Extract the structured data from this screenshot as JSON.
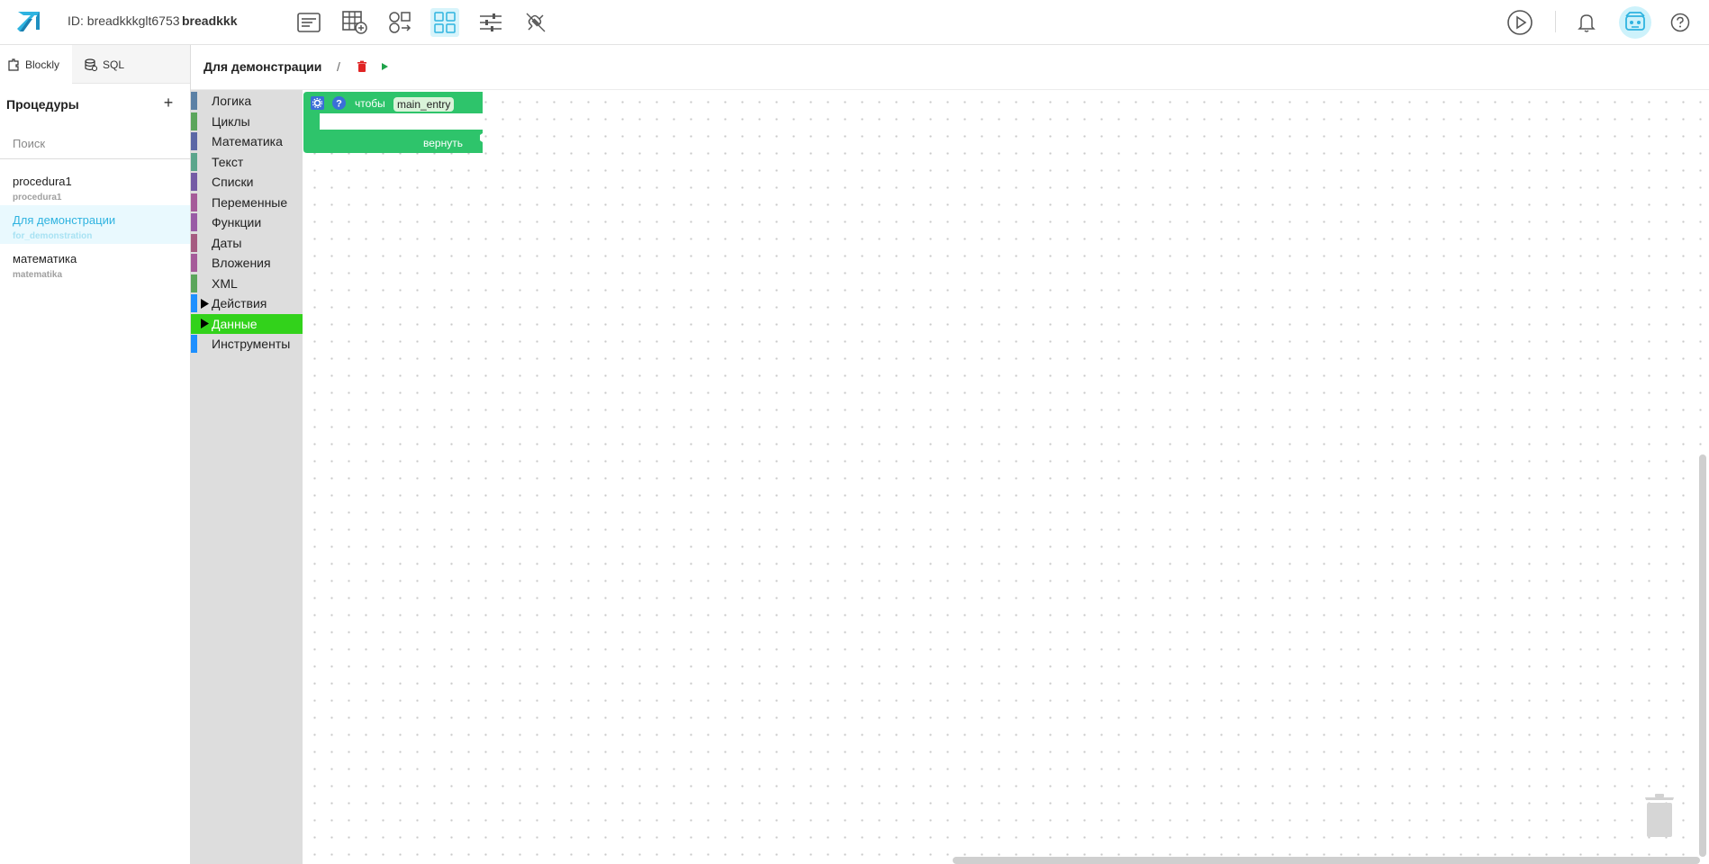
{
  "topbar": {
    "project_id": "ID: breadkkkglt6753",
    "project_name": "breadkkk",
    "tools": [
      "form-icon",
      "table-add-icon",
      "components-icon",
      "blocks-icon",
      "settings-sliders-icon",
      "plugin-icon"
    ],
    "active_tool": "blocks-icon"
  },
  "sidebar": {
    "tabs": [
      {
        "label": "Blockly",
        "icon": "blockly-icon",
        "active": true
      },
      {
        "label": "SQL",
        "icon": "sql-icon",
        "active": false
      }
    ],
    "header": "Процедуры",
    "search_placeholder": "Поиск",
    "procedures": [
      {
        "name": "procedura1",
        "code": "procedura1",
        "active": false
      },
      {
        "name": "Для демонстрации",
        "code": "for_demonstration",
        "active": true
      },
      {
        "name": "математика",
        "code": "matematika",
        "active": false
      }
    ]
  },
  "editor": {
    "title": "Для демонстрации",
    "separator": "/"
  },
  "toolbox": {
    "categories": [
      {
        "label": "Логика",
        "color": "#5b80a5",
        "expandable": false
      },
      {
        "label": "Циклы",
        "color": "#5ba55b",
        "expandable": false
      },
      {
        "label": "Математика",
        "color": "#5b67a5",
        "expandable": false
      },
      {
        "label": "Текст",
        "color": "#5ba58c",
        "expandable": false
      },
      {
        "label": "Списки",
        "color": "#745ba5",
        "expandable": false
      },
      {
        "label": "Переменные",
        "color": "#a55b99",
        "expandable": false
      },
      {
        "label": "Функции",
        "color": "#995ba5",
        "expandable": false
      },
      {
        "label": "Даты",
        "color": "#a55b80",
        "expandable": false
      },
      {
        "label": "Вложения",
        "color": "#a55b99",
        "expandable": false
      },
      {
        "label": "XML",
        "color": "#5ba55b",
        "expandable": false
      },
      {
        "label": "Действия",
        "color": "#1e90ff",
        "expandable": true
      },
      {
        "label": "Данные",
        "color": "#32d21b",
        "expandable": true,
        "selected": true
      },
      {
        "label": "Инструменты",
        "color": "#1e90ff",
        "expandable": false
      }
    ]
  },
  "block": {
    "keyword": "чтобы",
    "name": "main_entry",
    "return_label": "вернуть",
    "color": "#2ec46b"
  },
  "colors": {
    "accent": "#2fb3e0",
    "delete": "#e02424",
    "run": "#1fa34a"
  }
}
